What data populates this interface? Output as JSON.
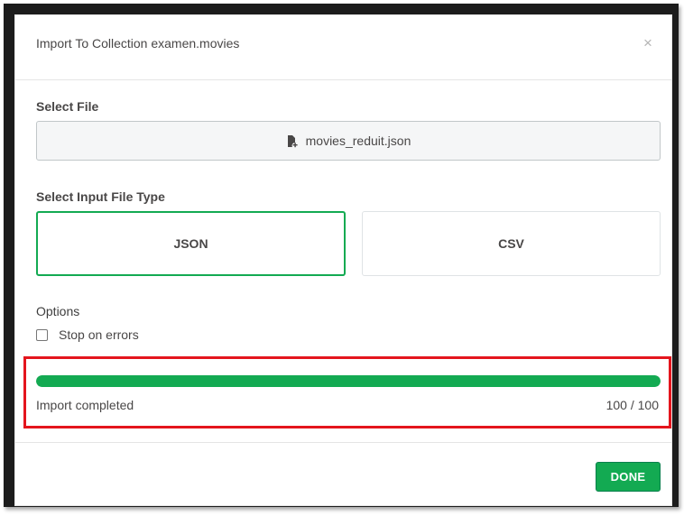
{
  "dialog": {
    "title": "Import To Collection examen.movies",
    "close_glyph": "×"
  },
  "file_section": {
    "label": "Select File",
    "file_name": "movies_reduit.json",
    "icon": "file-add-icon"
  },
  "type_section": {
    "label": "Select Input File Type",
    "options": [
      {
        "label": "JSON",
        "selected": true
      },
      {
        "label": "CSV",
        "selected": false
      }
    ]
  },
  "options_section": {
    "label": "Options",
    "stop_on_errors": {
      "label": "Stop on errors",
      "checked": false
    }
  },
  "progress": {
    "status": "Import completed",
    "count_text": "100 / 100",
    "fraction": 1.0
  },
  "footer": {
    "done_label": "DONE"
  },
  "colors": {
    "accent": "#13aa52",
    "highlight": "#e4151d",
    "text": "#494747"
  }
}
